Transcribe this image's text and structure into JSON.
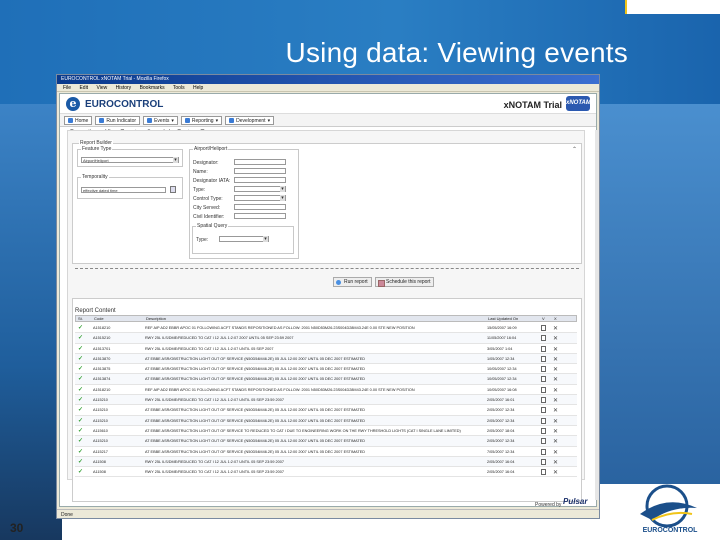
{
  "slide": {
    "title": "Using data: Viewing events",
    "number": "30",
    "footer_logo_text": "EUROCONTROL"
  },
  "browser": {
    "window_title": "EUROCONTROL xNOTAM Trial - Mozilla Firefox",
    "menu": [
      "File",
      "Edit",
      "View",
      "History",
      "Bookmarks",
      "Tools",
      "Help"
    ],
    "status": "Done"
  },
  "app": {
    "brand": "EUROCONTROL",
    "product": "xNOTAM Trial",
    "badge": "xNOTAM",
    "nav": [
      "Home",
      "Run Indicator",
      "Events",
      "Reporting",
      "Development"
    ],
    "breadcrumb": "Reporting > View Events > Search by Feature Type",
    "powered_by": "Powered by",
    "powered_logo": "Pulsar"
  },
  "builder": {
    "legend": "Report Builder",
    "feature_type_legend": "Feature Type",
    "feature_type_value": "AirportHeliport",
    "temporality_legend": "Temporality",
    "temporality_value": "effective dated time",
    "airport_legend": "Airport/Heliport",
    "fields": [
      "Designator:",
      "Name:",
      "Designator IATA:",
      "Type:",
      "Control Type:",
      "City Served:",
      "Civil Identifier:"
    ],
    "spatial_legend": "Spatial Query",
    "spatial_label": "Type:",
    "spatial_value": "",
    "run_label": "Run report",
    "schedule_label": "Schedule this report"
  },
  "report": {
    "legend": "Report Content",
    "columns": [
      "St.",
      "Code",
      "Description",
      "Last Updated On",
      "V",
      "X"
    ],
    "rows": [
      {
        "code": "A1518210",
        "desc": "REF AIP AD2 EBBR APOC 01 FOLLOWING ACFT STANDS REPOSITIONED AS FOLLOW: 2001 N50D53M26.23S004D28M43.24E 0.00 STE NEW POSITION",
        "date": "15/05/2007 16:09"
      },
      {
        "code": "A1515210",
        "desc": "RWY 25L ILS/DME/REDUCED TO CAT I 12 JUL 1:2:07 2007 UNTIL 05 SEP 23:59 2007",
        "date": "11/05/2007 16:04"
      },
      {
        "code": "A1513701",
        "desc": "RWY 25L ILS/DME/REDUCED TO CAT I 12 JUL 1:2:07 UNTIL 05 SEP 2007",
        "date": "3/05/2007 1:04"
      },
      {
        "code": "A1513870",
        "desc": "AT EBBE ASR/OBSTRUCTION LIGHT OUT OF SERVICE (N50D54M46.2E) 05 JUL 12:00 2007 UNTIL 05 DEC 2007 ESTIMATED",
        "date": "1/05/2007 12:34"
      },
      {
        "code": "A1513875",
        "desc": "AT EBBE ASR/OBSTRUCTION LIGHT OUT OF SERVICE (N50D54M46.2E) 05 JUL 12:00 2007 UNTIL 05 DEC 2007 ESTIMATED",
        "date": "10/05/2007 12:34"
      },
      {
        "code": "A1513874",
        "desc": "AT EBBE ASR/OBSTRUCTION LIGHT OUT OF SERVICE (N50D54M46.2E) 05 JUL 12:00 2007 UNTIL 05 DEC 2007 ESTIMATED",
        "date": "10/05/2007 12:34"
      },
      {
        "code": "A1518210",
        "desc": "REF AIP AD2 EBBR APOC 01 FOLLOWING ACFT STANDS REPOSITIONED AS FOLLOW: 2001 N50D53M26.23S004D28M43.24E 0.00 STE NEW POSITION",
        "date": "10/05/2007 16:08"
      },
      {
        "code": "A115210",
        "desc": "RWY 25L ILS/DME/REDUCED TO CAT I 12 JUL 1:2:07 UNTIL 05 SEP 23:59 2007",
        "date": "2/05/2007 16:01"
      },
      {
        "code": "A115210",
        "desc": "AT EBBE ASR/OBSTRUCTION LIGHT OUT OF SERVICE (N50D54M46.2E) 05 JUL 12:00 2007 UNTIL 05 DEC 2007 ESTIMATED",
        "date": "2/05/2007 12:34"
      },
      {
        "code": "A115210",
        "desc": "AT EBBE ASR/OBSTRUCTION LIGHT OUT OF SERVICE (N50D54M46.2E) 05 JUL 12:00 2007 UNTIL 05 DEC 2007 ESTIMATED",
        "date": "2/05/2007 12:34"
      },
      {
        "code": "A115610",
        "desc": "AT EBBE ASR/OBSTRUCTION LIGHT OUT OF SERVICE TO REDUCED TO CAT I DUE TO ENGINEERING WORK ON THE RWY THRESHOLD LIGHTS (CAT I SINGLE LANE LIMITED)",
        "date": "2/05/2007 18:04"
      },
      {
        "code": "A115210",
        "desc": "AT EBBE ASR/OBSTRUCTION LIGHT OUT OF SERVICE (N50D54M46.2E) 05 JUL 12:00 2007 UNTIL 05 DEC 2007 ESTIMATED",
        "date": "2/05/2007 12:34"
      },
      {
        "code": "A115217",
        "desc": "AT EBBE ASR/OBSTRUCTION LIGHT OUT OF SERVICE (N50D54M46.2E) 05 JUL 12:00 2007 UNTIL 05 DEC 2007 ESTIMATED",
        "date": "7/05/2007 12:34"
      },
      {
        "code": "A11508",
        "desc": "RWY 25L ILS/DME/REDUCED TO CAT I 12 JUL 1:2:07 UNTIL 05 SEP 23:59 2007",
        "date": "2/05/2007 16:04"
      },
      {
        "code": "A11508",
        "desc": "RWY 25L ILS/DME/REDUCED TO CAT I 12 JUL 1:2:07 UNTIL 05 SEP 23:59 2007",
        "date": "2/05/2007 16:04"
      }
    ]
  }
}
